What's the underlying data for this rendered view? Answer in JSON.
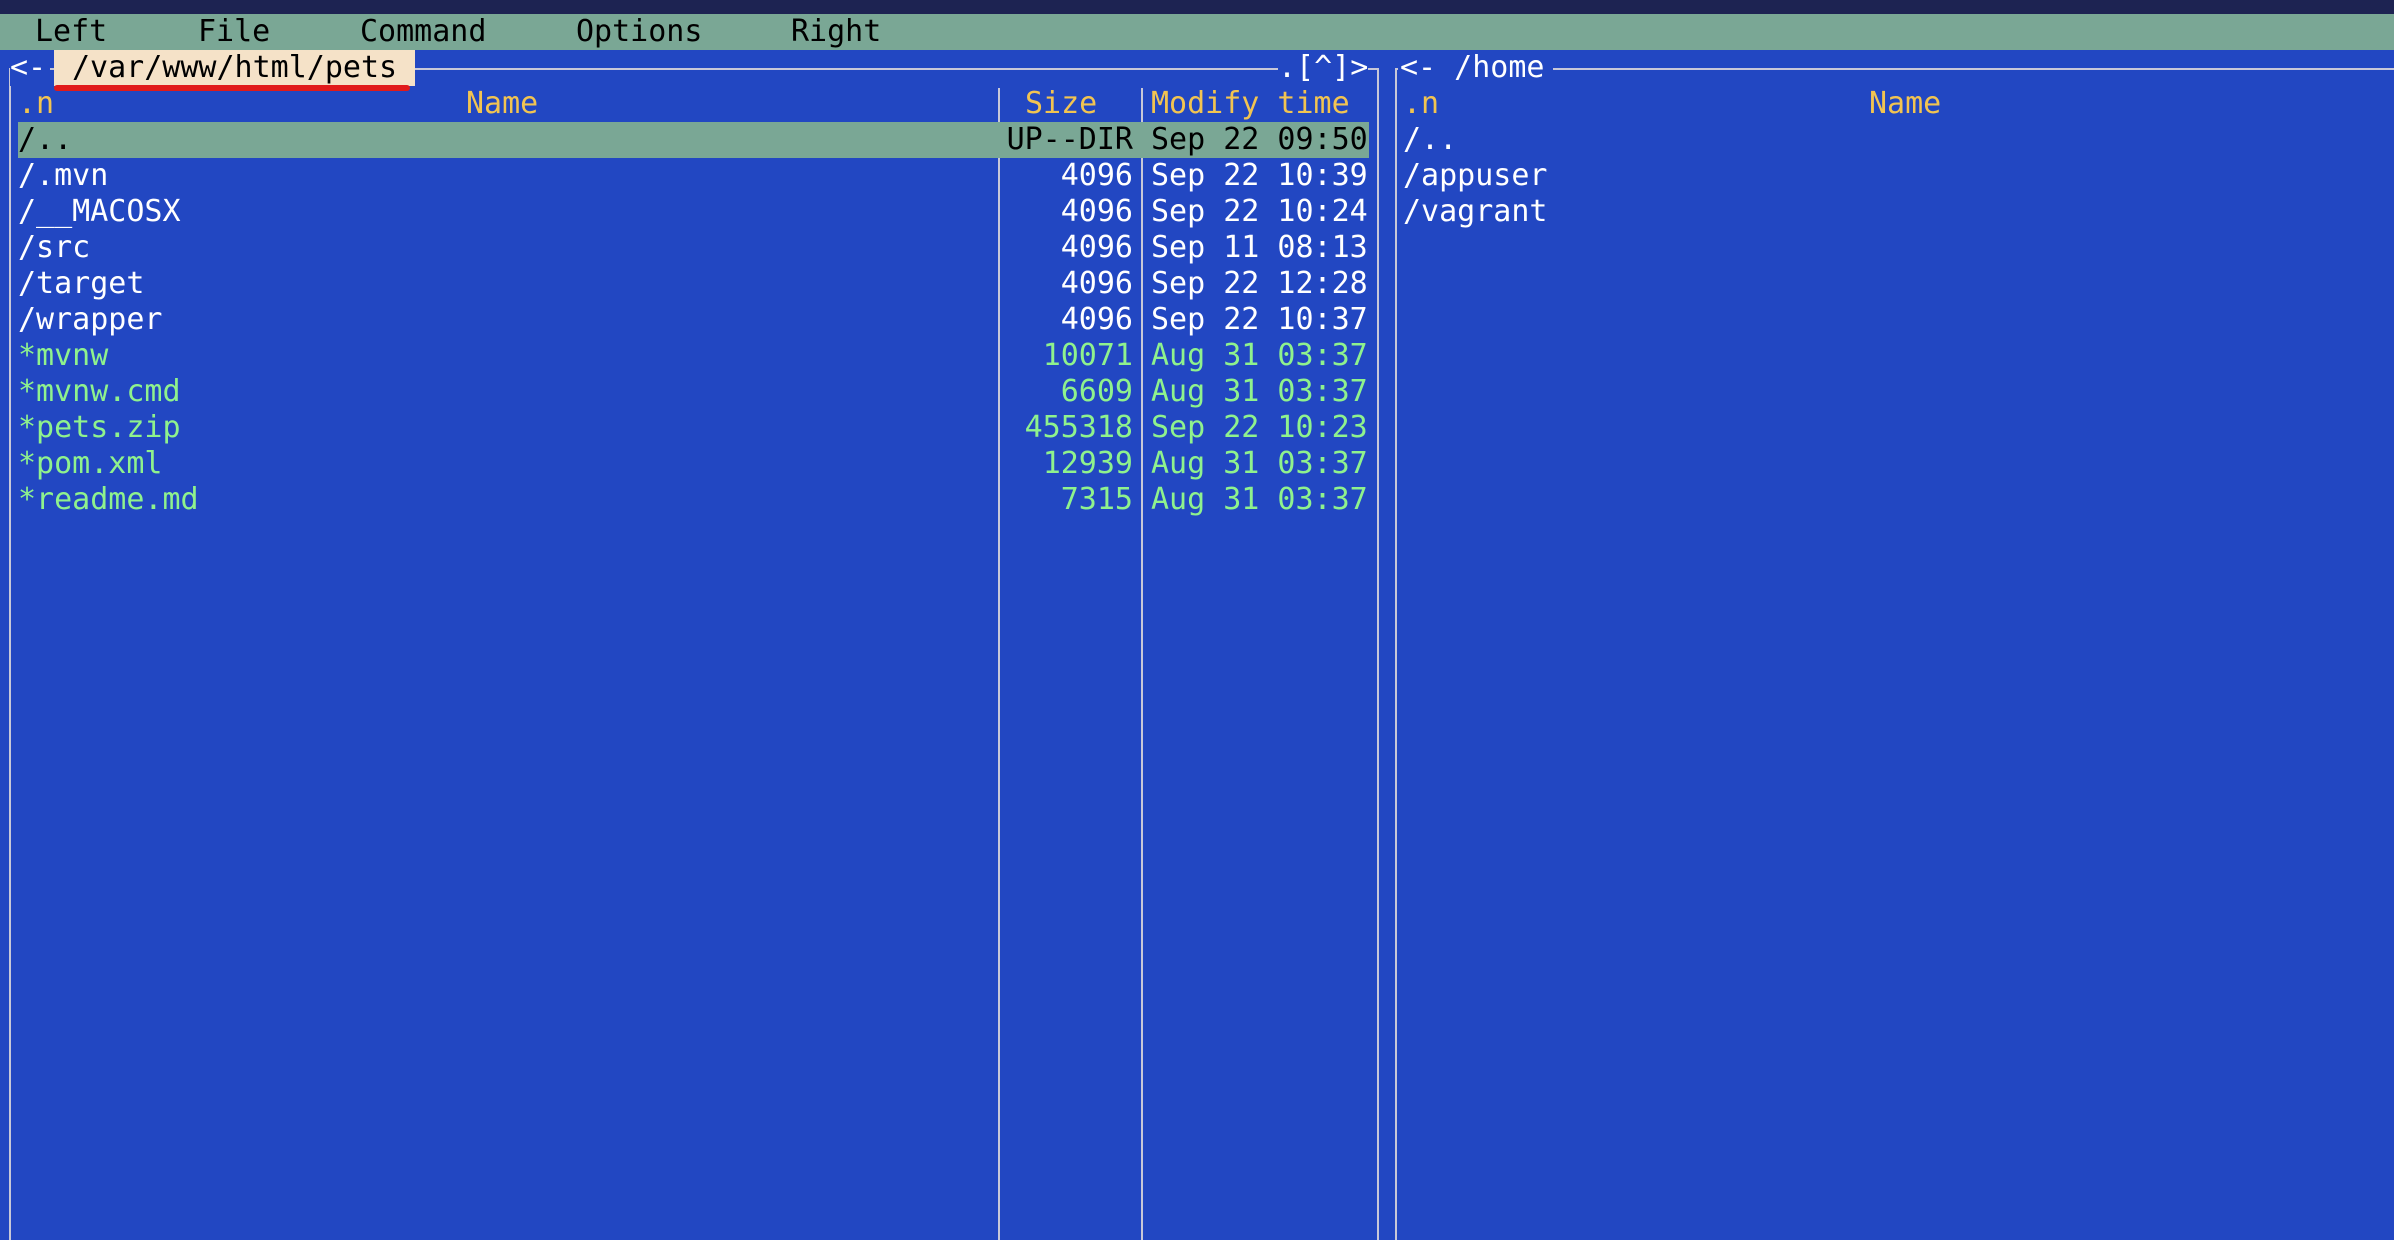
{
  "menubar": {
    "items": [
      "Left",
      "File",
      "Command",
      "Options",
      "Right"
    ]
  },
  "left_panel": {
    "title_prefix": "<-",
    "path": "/var/www/html/pets",
    "right_controls": ".[^]>",
    "headers": {
      "sort": ".n",
      "name": "Name",
      "size": "Size",
      "mtime": "Modify time"
    },
    "rows": [
      {
        "name": "/..",
        "size": "UP--DIR",
        "mtime": "Sep 22 09:50",
        "kind": "selected"
      },
      {
        "name": "/.mvn",
        "size": "4096",
        "mtime": "Sep 22 10:39",
        "kind": "dir"
      },
      {
        "name": "/__MACOSX",
        "size": "4096",
        "mtime": "Sep 22 10:24",
        "kind": "dir"
      },
      {
        "name": "/src",
        "size": "4096",
        "mtime": "Sep 11 08:13",
        "kind": "dir"
      },
      {
        "name": "/target",
        "size": "4096",
        "mtime": "Sep 22 12:28",
        "kind": "dir"
      },
      {
        "name": "/wrapper",
        "size": "4096",
        "mtime": "Sep 22 10:37",
        "kind": "dir"
      },
      {
        "name": "*mvnw",
        "size": "10071",
        "mtime": "Aug 31 03:37",
        "kind": "exec"
      },
      {
        "name": "*mvnw.cmd",
        "size": "6609",
        "mtime": "Aug 31 03:37",
        "kind": "exec"
      },
      {
        "name": "*pets.zip",
        "size": "455318",
        "mtime": "Sep 22 10:23",
        "kind": "exec"
      },
      {
        "name": "*pom.xml",
        "size": "12939",
        "mtime": "Aug 31 03:37",
        "kind": "exec"
      },
      {
        "name": "*readme.md",
        "size": "7315",
        "mtime": "Aug 31 03:37",
        "kind": "exec"
      }
    ]
  },
  "right_panel": {
    "title": "<- /home",
    "headers": {
      "sort": ".n",
      "name": "Name"
    },
    "rows": [
      {
        "name": "/.."
      },
      {
        "name": "/appuser"
      },
      {
        "name": "/vagrant"
      }
    ]
  },
  "colors": {
    "background": "#2247c2",
    "menubar": "#7aa795",
    "header_text": "#f2c451",
    "exec_text": "#8ff28d",
    "active_path_bg": "#f5e2c8",
    "active_path_underline": "#e11a1a"
  }
}
